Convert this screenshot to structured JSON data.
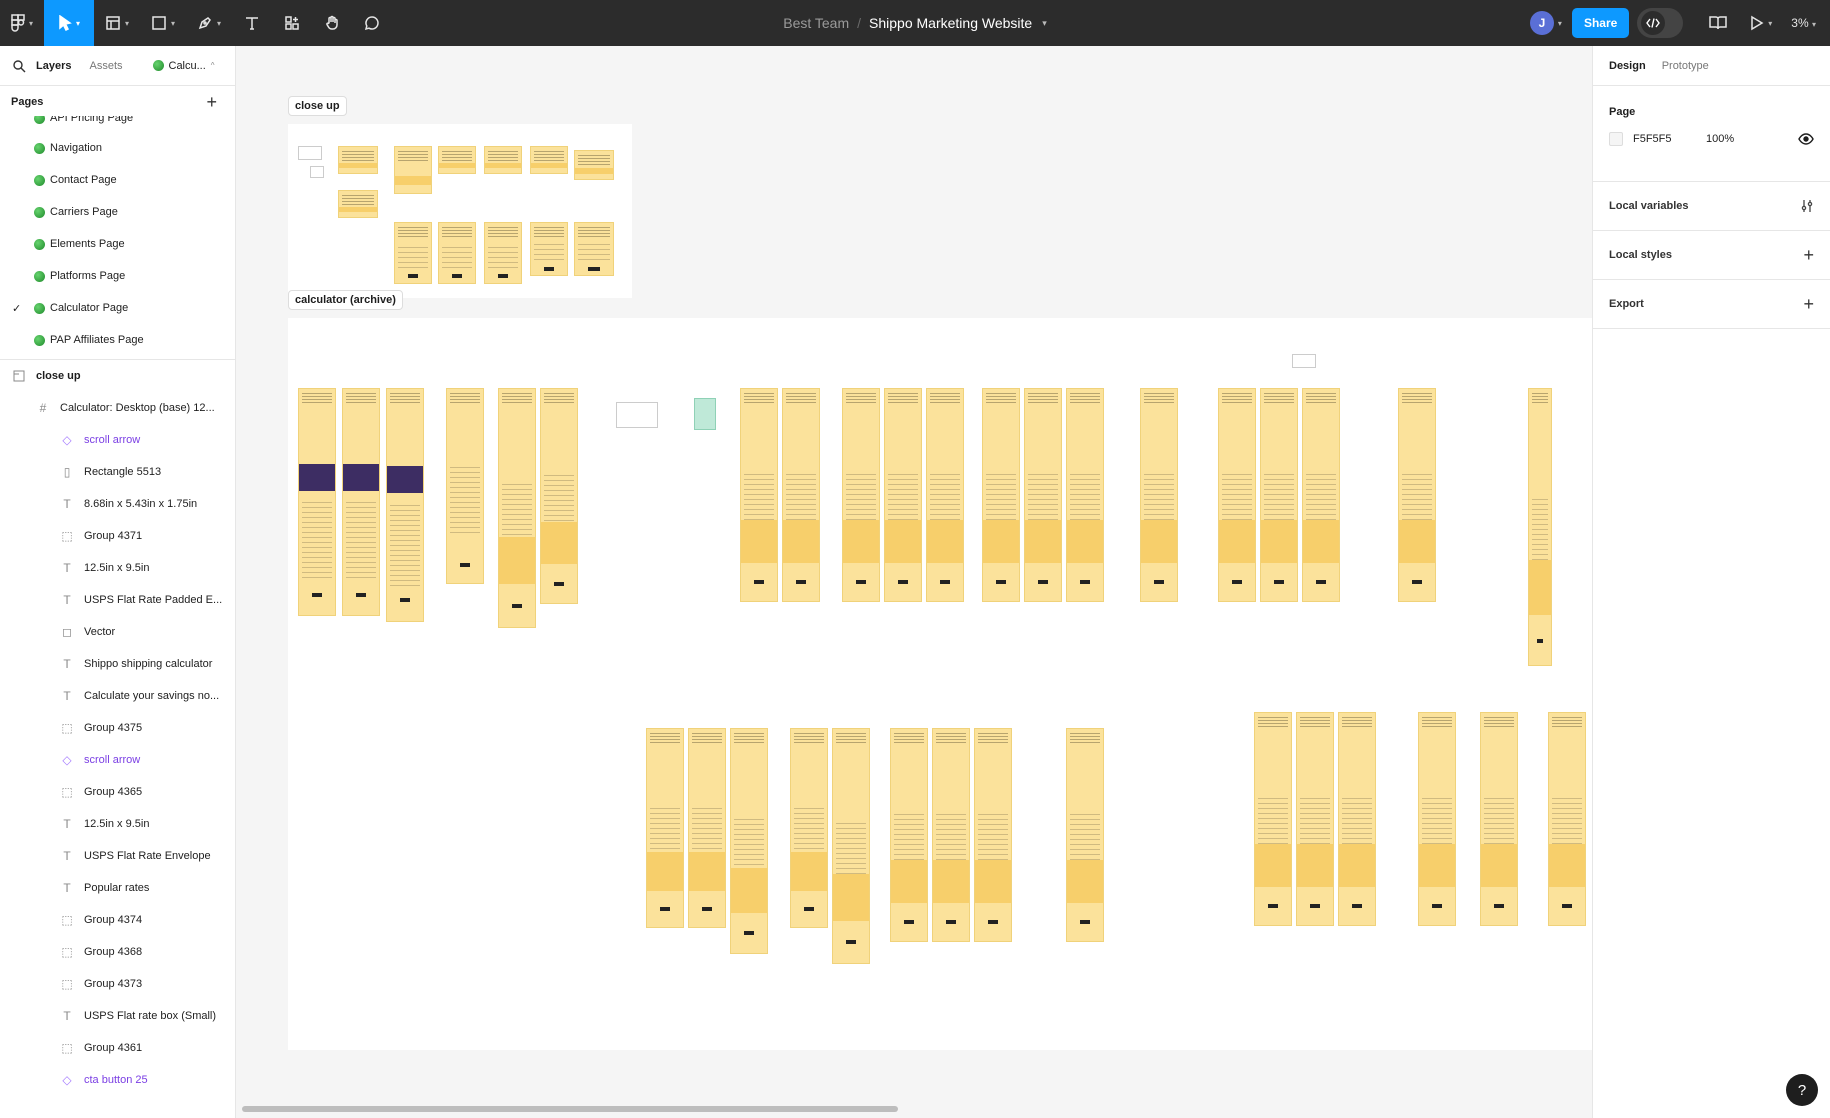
{
  "toolbar": {
    "breadcrumb_team": "Best Team",
    "breadcrumb_sep": "/",
    "file_name": "Shippo Marketing Website",
    "share_label": "Share",
    "avatar_initial": "J",
    "zoom": "3%"
  },
  "left_panel": {
    "tab_layers": "Layers",
    "tab_assets": "Assets",
    "current_page_chip": "Calcu...",
    "pages_title": "Pages",
    "pages": [
      "API Pricing Page",
      "Navigation",
      "Contact Page",
      "Carriers Page",
      "Elements Page",
      "Platforms Page",
      "Calculator Page",
      "PAP Affiliates Page"
    ],
    "layers": [
      "close up",
      "Calculator: Desktop (base) 12...",
      "scroll arrow",
      "Rectangle 5513",
      "8.68in x 5.43in x 1.75in",
      "Group 4371",
      "12.5in x 9.5in",
      "USPS Flat Rate Padded E...",
      "Vector",
      "Shippo shipping calculator",
      "Calculate your savings no...",
      "Group 4375",
      "scroll arrow",
      "Group 4365",
      "12.5in x 9.5in",
      "USPS Flat Rate Envelope",
      "Popular rates",
      "Group 4374",
      "Group 4368",
      "Group 4373",
      "USPS Flat rate box (Small)",
      "Group 4361",
      "cta button 25"
    ]
  },
  "canvas": {
    "section_close_up": "close up",
    "section_archive": "calculator (archive)",
    "background": "#F5F5F5"
  },
  "right_panel": {
    "tab_design": "Design",
    "tab_prototype": "Prototype",
    "page_title": "Page",
    "page_color": "F5F5F5",
    "page_opacity": "100%",
    "local_variables": "Local variables",
    "local_styles": "Local styles",
    "export": "Export",
    "help": "?"
  },
  "colors": {
    "accent": "#0d99ff",
    "toolbar_bg": "#2c2c2c",
    "page_dot": "#2ca02c",
    "component": "#7b3fe4",
    "board_yellow": "#fbe29b"
  }
}
